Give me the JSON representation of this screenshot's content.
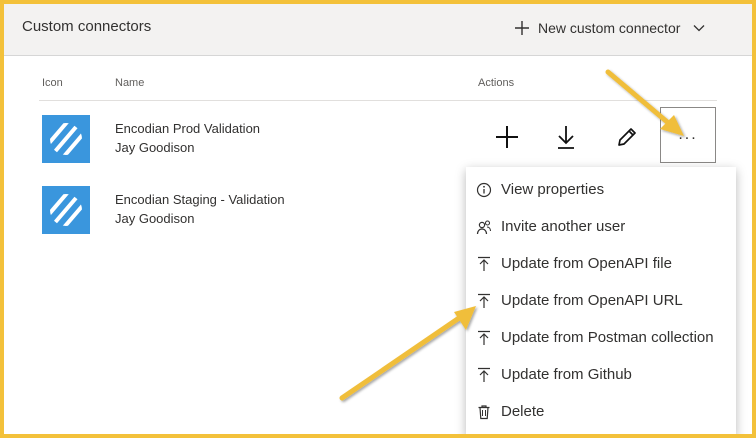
{
  "header": {
    "title": "Custom connectors",
    "new_button_label": "New custom connector"
  },
  "table": {
    "columns": [
      "Icon",
      "Name",
      "Actions"
    ],
    "rows": [
      {
        "name": "Encodian Prod Validation",
        "owner": "Jay Goodison"
      },
      {
        "name": "Encodian Staging - Validation",
        "owner": "Jay Goodison"
      }
    ],
    "more_label": "..."
  },
  "menu": {
    "items": [
      {
        "label": "View properties",
        "icon": "info-icon"
      },
      {
        "label": "Invite another user",
        "icon": "invite-user-icon"
      },
      {
        "label": "Update from OpenAPI file",
        "icon": "upload-icon"
      },
      {
        "label": "Update from OpenAPI URL",
        "icon": "upload-icon"
      },
      {
        "label": "Update from Postman collection",
        "icon": "upload-icon"
      },
      {
        "label": "Update from Github",
        "icon": "upload-icon"
      },
      {
        "label": "Delete",
        "icon": "trash-icon"
      }
    ]
  },
  "colors": {
    "frame_border": "#f3c13a",
    "connector_icon_bg": "#3a96dd",
    "annotation_arrow": "#f0be3b"
  }
}
